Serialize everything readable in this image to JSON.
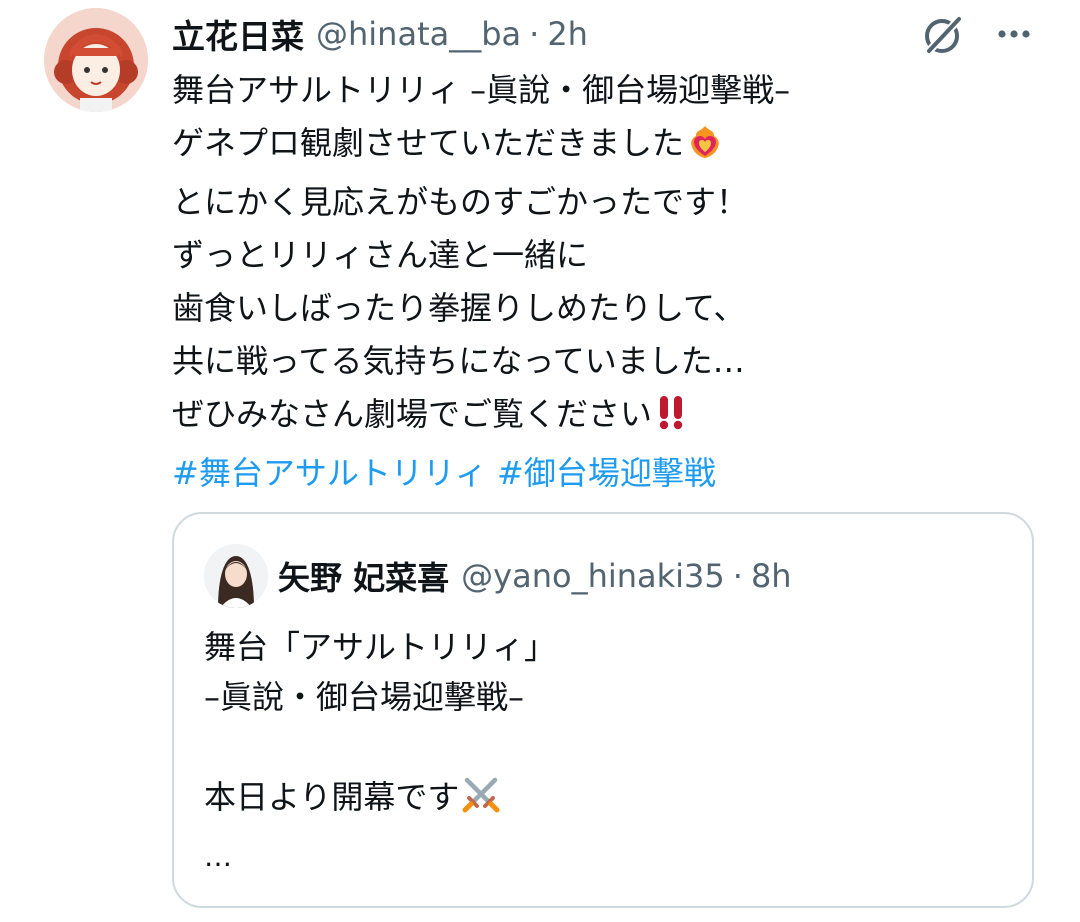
{
  "tweet": {
    "display_name": "立花日菜",
    "handle": "@hinata__ba",
    "separator": "·",
    "time": "2h",
    "lines": [
      "舞台アサルトリリィ –眞說・御台場迎擊戦–",
      "ゲネプロ観劇させていただきました",
      "とにかく見応えがものすごかったです！",
      "ずっとリリィさん達と一緒に",
      "歯食いしばったり拳握りしめたりして、",
      "共に戦ってる気持ちになっていました…",
      "ぜひみなさん劇場でご覧ください"
    ],
    "hashtags": [
      "#舞台アサルトリリィ",
      "#御台場迎擊戦"
    ],
    "emojis": {
      "heart_on_fire": "heart-on-fire-emoji",
      "double_exclamation": "double-exclamation-emoji"
    }
  },
  "quoted_tweet": {
    "display_name": "矢野 妃菜喜",
    "handle": "@yano_hinaki35",
    "separator": "·",
    "time": "8h",
    "lines": [
      "舞台「アサルトリリィ」",
      "–眞說・御台場迎擊戦–",
      "",
      "本日より開幕です"
    ],
    "more": "…",
    "emojis": {
      "crossed_swords": "crossed-swords-emoji"
    }
  },
  "icons": {
    "grok": "grok-icon",
    "more": "more-options-icon"
  },
  "colors": {
    "text": "#0f1419",
    "secondary": "#536471",
    "link": "#1d9bf0",
    "border": "#cfd9de"
  }
}
